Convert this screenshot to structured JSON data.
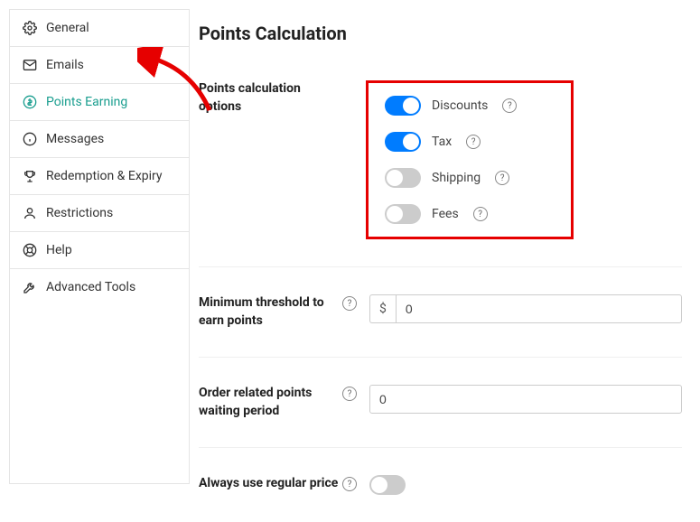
{
  "sidebar": {
    "items": [
      {
        "label": "General"
      },
      {
        "label": "Emails"
      },
      {
        "label": "Points Earning"
      },
      {
        "label": "Messages"
      },
      {
        "label": "Redemption & Expiry"
      },
      {
        "label": "Restrictions"
      },
      {
        "label": "Help"
      },
      {
        "label": "Advanced Tools"
      }
    ]
  },
  "page": {
    "title": "Points Calculation"
  },
  "settings": {
    "calc_options": {
      "label": "Points calculation options",
      "toggles": [
        {
          "label": "Discounts",
          "on": true
        },
        {
          "label": "Tax",
          "on": true
        },
        {
          "label": "Shipping",
          "on": false
        },
        {
          "label": "Fees",
          "on": false
        }
      ]
    },
    "min_threshold": {
      "label": "Minimum threshold to earn points",
      "prefix": "$",
      "value": "0"
    },
    "waiting_period": {
      "label": "Order related points waiting period",
      "value": "0"
    },
    "regular_price": {
      "label": "Always use regular price",
      "on": false
    }
  }
}
